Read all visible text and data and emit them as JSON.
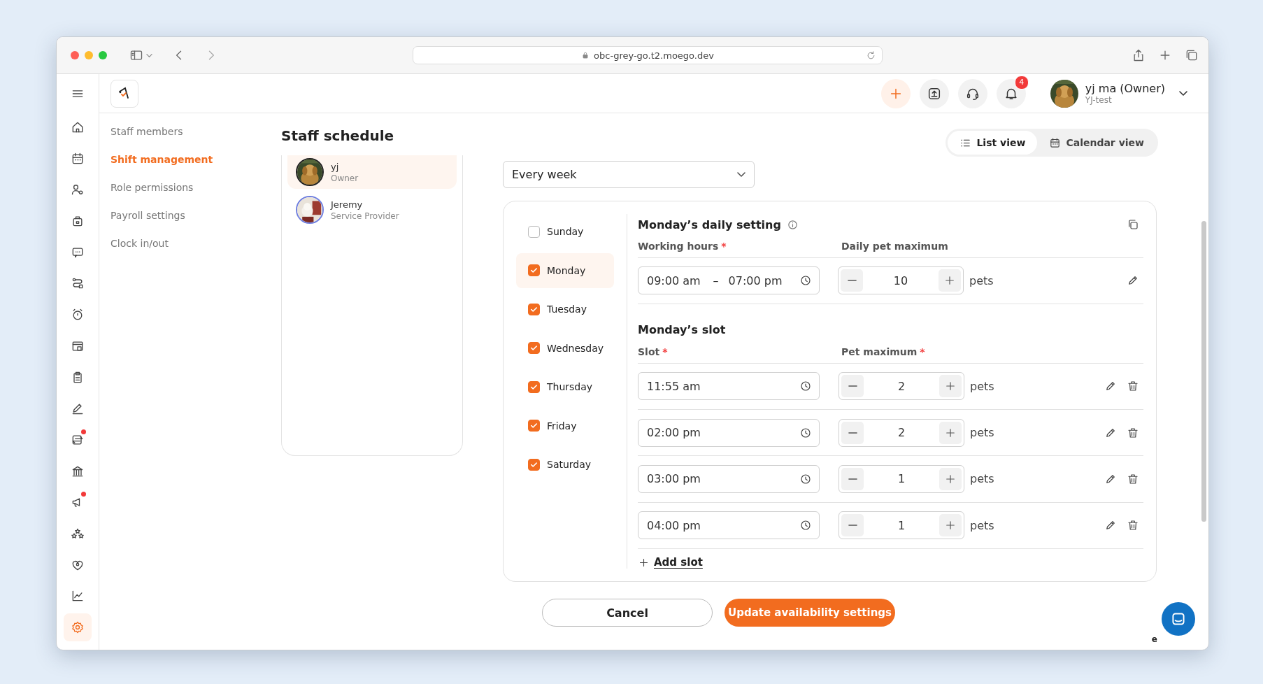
{
  "browser": {
    "url": "obc-grey-go.t2.moego.dev"
  },
  "rail": [
    {
      "kind": "home",
      "selected": false,
      "dot": false
    },
    {
      "kind": "calendar",
      "selected": false,
      "dot": false
    },
    {
      "kind": "client",
      "selected": false,
      "dot": false
    },
    {
      "kind": "bag",
      "selected": false,
      "dot": false
    },
    {
      "kind": "chat",
      "selected": false,
      "dot": false
    },
    {
      "kind": "route",
      "selected": false,
      "dot": false
    },
    {
      "kind": "alarm",
      "selected": false,
      "dot": false
    },
    {
      "kind": "store",
      "selected": false,
      "dot": false
    },
    {
      "kind": "clipboard",
      "selected": false,
      "dot": false
    },
    {
      "kind": "pen",
      "selected": false,
      "dot": false
    },
    {
      "kind": "exchange",
      "selected": false,
      "dot": true
    },
    {
      "kind": "bank",
      "selected": false,
      "dot": false
    },
    {
      "kind": "megaphone",
      "selected": false,
      "dot": true
    },
    {
      "kind": "stars",
      "selected": false,
      "dot": false
    },
    {
      "kind": "heart",
      "selected": false,
      "dot": false
    },
    {
      "kind": "chart",
      "selected": false,
      "dot": false
    },
    {
      "kind": "gear",
      "selected": true,
      "dot": false
    }
  ],
  "topbar": {
    "notifications": "4",
    "user_name": "yj ma (Owner)",
    "business": "YJ-test"
  },
  "subnav": [
    {
      "label": "Staff members",
      "selected": false
    },
    {
      "label": "Shift management",
      "selected": true
    },
    {
      "label": "Role permissions",
      "selected": false
    },
    {
      "label": "Payroll settings",
      "selected": false
    },
    {
      "label": "Clock in/out",
      "selected": false
    }
  ],
  "page_title": "Staff schedule",
  "staff": [
    {
      "name": "yj",
      "role": "Owner",
      "selected": true
    },
    {
      "name": "Jeremy",
      "role": "Service Provider",
      "selected": false
    }
  ],
  "view_toggle": [
    {
      "label": "List view",
      "selected": true
    },
    {
      "label": "Calendar view",
      "selected": false
    }
  ],
  "repeat": {
    "value": "Every week"
  },
  "days": [
    {
      "label": "Sunday",
      "checked": false,
      "selected": false
    },
    {
      "label": "Monday",
      "checked": true,
      "selected": true
    },
    {
      "label": "Tuesday",
      "checked": true,
      "selected": false
    },
    {
      "label": "Wednesday",
      "checked": true,
      "selected": false
    },
    {
      "label": "Thursday",
      "checked": true,
      "selected": false
    },
    {
      "label": "Friday",
      "checked": true,
      "selected": false
    },
    {
      "label": "Saturday",
      "checked": true,
      "selected": false
    }
  ],
  "daily": {
    "title": "Monday’s daily setting",
    "hours_label": "Working hours",
    "hours_mark": "*",
    "max_label": "Daily pet maximum",
    "start": "09:00 am",
    "dash": "–",
    "end": "07:00 pm",
    "value": "10",
    "unit": "pets"
  },
  "slots": {
    "title": "Monday’s slot",
    "slot_label": "Slot",
    "slot_mark": "*",
    "max_label": "Pet maximum",
    "max_mark": "*",
    "rows": [
      {
        "time": "11:55 am",
        "value": "2",
        "unit": "pets"
      },
      {
        "time": "02:00 pm",
        "value": "2",
        "unit": "pets"
      },
      {
        "time": "03:00 pm",
        "value": "1",
        "unit": "pets"
      },
      {
        "time": "04:00 pm",
        "value": "1",
        "unit": "pets"
      }
    ],
    "add": "Add slot"
  },
  "buttons": {
    "cancel": "Cancel",
    "submit": "Update availability settings"
  },
  "chat_fragment": "e"
}
